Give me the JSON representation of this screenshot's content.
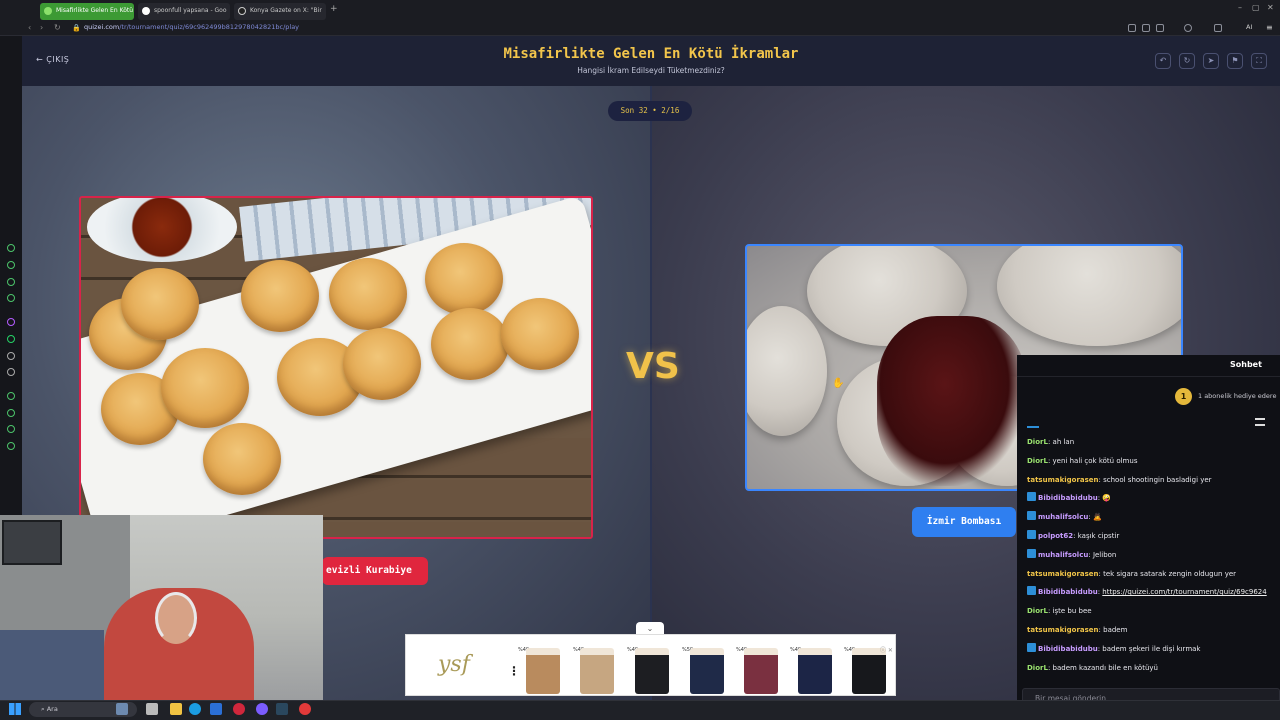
{
  "browser": {
    "tabs": [
      {
        "label": "Misafirlikte Gelen En Kötü",
        "active": true,
        "favicon_color": "#5fb84b"
      },
      {
        "label": "spoonfull yapsana - Goo",
        "active": false,
        "favicon_color": "#ffffff"
      },
      {
        "label": "Konya Gazete on X: \"Bir",
        "active": false,
        "favicon_color": "#ffffff"
      }
    ],
    "url_domain": "quizei.com",
    "url_path": "/tr/tournament/quiz/69c962499b812978042821bc/play"
  },
  "header": {
    "exit_label": "ÇIKIŞ",
    "title": "Misafirlikte Gelen En Kötü İkramlar",
    "subtitle": "Hangisi İkram Edilseydi Tüketmezdiniz?",
    "round_label": "Son 32 • 2/16"
  },
  "matchup": {
    "left": {
      "name": "Cevizli Kurabiye",
      "visible_label": "evizli Kurabiye",
      "border_color": "#d8234a"
    },
    "right": {
      "name": "İzmir Bombası",
      "border_color": "#3a86ff"
    },
    "vs_label": "VS"
  },
  "chat": {
    "title": "Sohbet",
    "sub_badge": "1",
    "sub_note": "1 abonelik hediye edere",
    "input_placeholder": "Bir mesaj gönderin",
    "messages": [
      {
        "user": "DiorL",
        "color": "#9be36f",
        "badge": false,
        "text": "ah lan"
      },
      {
        "user": "DiorL",
        "color": "#9be36f",
        "badge": false,
        "text": "yeni hali çok kötü olmus"
      },
      {
        "user": "tatsumakigorasen",
        "color": "#f0c448",
        "badge": false,
        "text": "school shootingin basladigi yer"
      },
      {
        "user": "Bibidibabidubu",
        "color": "#c79cff",
        "badge": true,
        "text": "🤪"
      },
      {
        "user": "muhalifsolcu",
        "color": "#c79cff",
        "badge": true,
        "text": "🙇"
      },
      {
        "user": "polpot62",
        "color": "#c79cff",
        "badge": true,
        "text": "kaşık cipstir"
      },
      {
        "user": "muhalifsolcu",
        "color": "#c79cff",
        "badge": true,
        "text": "Jelibon"
      },
      {
        "user": "tatsumakigorasen",
        "color": "#f0c448",
        "badge": false,
        "text": "tek sigara satarak zengin oldugun yer"
      },
      {
        "user": "Bibidibabidubu",
        "color": "#c79cff",
        "badge": true,
        "text": "https://quizei.com/tr/tournament/quiz/69c9624"
      },
      {
        "user": "DiorL",
        "color": "#9be36f",
        "badge": false,
        "text": "işte bu bee"
      },
      {
        "user": "tatsumakigorasen",
        "color": "#f0c448",
        "badge": false,
        "text": "badem"
      },
      {
        "user": "Bibidibabidubu",
        "color": "#c79cff",
        "badge": true,
        "text": "badem şekeri ile dişi kırmak"
      },
      {
        "user": "DiorL",
        "color": "#9be36f",
        "badge": false,
        "text": "badem kazandı bile en kötüyü"
      }
    ]
  },
  "ad": {
    "brand": "ysf",
    "prices": [
      "%49",
      "%49",
      "%49",
      "%50",
      "%49",
      "%49",
      "%49"
    ]
  },
  "taskbar": {
    "search_placeholder": "Ara"
  }
}
